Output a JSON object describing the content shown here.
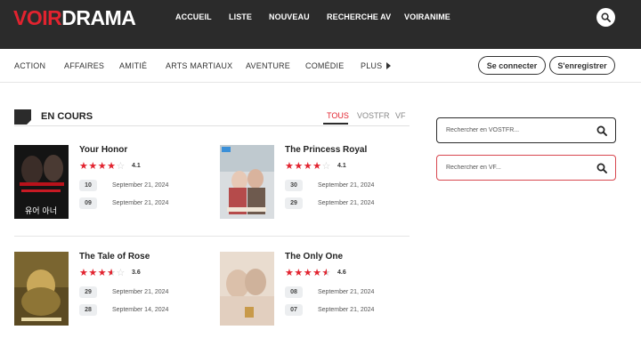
{
  "site": {
    "logo_part1": "VOIR",
    "logo_part2": "DRAMA"
  },
  "nav": [
    "ACCUEIL",
    "LISTE",
    "NOUVEAU",
    "RECHERCHE AV",
    "VOIRANIME"
  ],
  "genres": [
    "ACTION",
    "AFFAIRES",
    "AMITIÉ",
    "ARTS MARTIAUX",
    "AVENTURE",
    "COMÉDIE",
    "PLUS"
  ],
  "auth": {
    "login": "Se connecter",
    "register": "S'enregistrer"
  },
  "section": {
    "title": "EN COURS",
    "tabs": [
      "TOUS",
      "VOSTFR",
      "VF"
    ],
    "active_tab": "TOUS"
  },
  "dramas": [
    {
      "title": "Your Honor",
      "rating": 4.1,
      "rating_label": "4.1",
      "episodes": [
        {
          "ep": "10",
          "date": "September 21, 2024"
        },
        {
          "ep": "09",
          "date": "September 21, 2024"
        }
      ]
    },
    {
      "title": "The Princess Royal",
      "rating": 4.1,
      "rating_label": "4.1",
      "episodes": [
        {
          "ep": "30",
          "date": "September 21, 2024"
        },
        {
          "ep": "29",
          "date": "September 21, 2024"
        }
      ]
    },
    {
      "title": "The Tale of Rose",
      "rating": 3.6,
      "rating_label": "3.6",
      "episodes": [
        {
          "ep": "29",
          "date": "September 21, 2024"
        },
        {
          "ep": "28",
          "date": "September 14, 2024"
        }
      ]
    },
    {
      "title": "The Only One",
      "rating": 4.6,
      "rating_label": "4.6",
      "episodes": [
        {
          "ep": "08",
          "date": "September 21, 2024"
        },
        {
          "ep": "07",
          "date": "September 21, 2024"
        }
      ]
    }
  ],
  "poster_texts": {
    "your_honor": "유어 아너"
  },
  "search": {
    "vostfr_placeholder": "Rechercher en VOSTFR...",
    "vf_placeholder": "Rechercher en VF..."
  },
  "icons": {
    "header_search": "search-icon",
    "vostfr_search": "search-icon",
    "vf_search": "search-icon",
    "more": "triangle-right-icon",
    "section": "section-marker-icon"
  },
  "colors": {
    "accent": "#e2232f",
    "header_bg": "#2b2b2b",
    "star_off": "#cfcfcf"
  }
}
